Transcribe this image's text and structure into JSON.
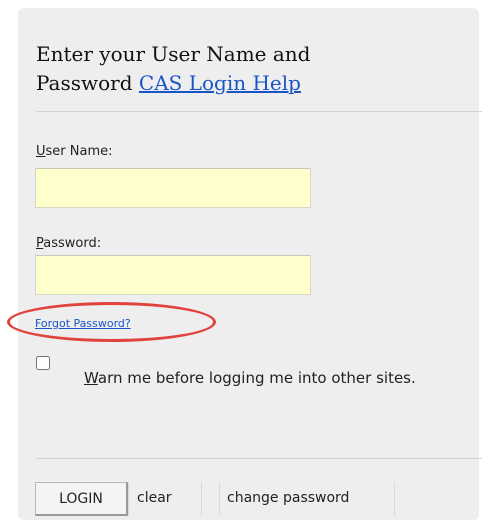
{
  "login_form": {
    "heading_line": "Enter your User Name and Password",
    "help_link": "CAS Login Help",
    "username_label_first": "U",
    "username_label_rest": "ser Name:",
    "username_value": "",
    "password_label_first": "P",
    "password_label_rest": "assword:",
    "password_value": "",
    "forgot_link": "Forgot Password?",
    "warn_checked": false,
    "warn_label_first": "W",
    "warn_label_rest": "arn me before logging me into other sites.",
    "login_button": "LOGIN",
    "clear_button": "clear",
    "change_password_button": "change password"
  },
  "colors": {
    "panel_background": "#eeeeee",
    "input_background": "#ffffcc",
    "link": "#1a55c8",
    "highlight_ellipse": "#e0433c"
  }
}
